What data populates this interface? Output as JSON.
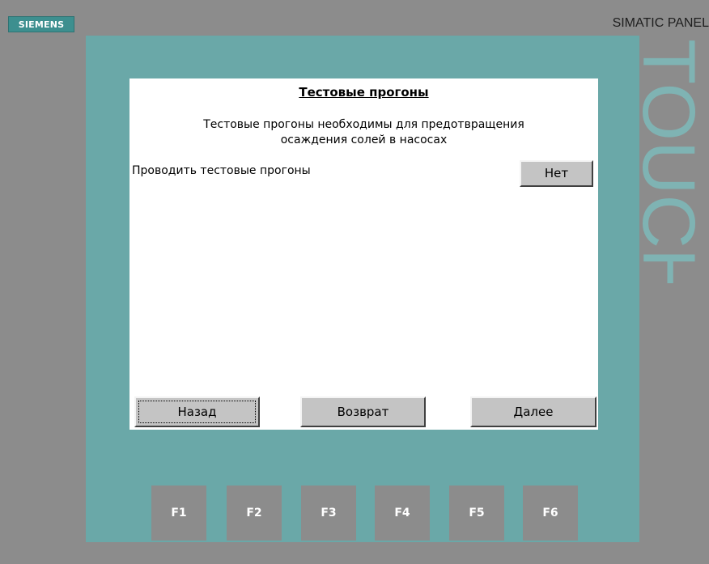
{
  "device": {
    "brand_logo": "SIEMENS",
    "model_label": "SIMATIC PANEL",
    "side_word": "TOUCH",
    "colors": {
      "housing": "#8c8c8c",
      "bezel": "#6aa8a8",
      "logo_bg": "#3d8f8f"
    }
  },
  "screen": {
    "title": "Тестовые прогоны",
    "description_line1": "Тестовые прогоны необходимы для предотвращения",
    "description_line2": "осаждения солей в  насосах",
    "option_label": "Проводить тестовые прогоны",
    "option_value": "Нет",
    "buttons": {
      "back": "Назад",
      "return": "Возврат",
      "next": "Далее"
    }
  },
  "function_keys": [
    "F1",
    "F2",
    "F3",
    "F4",
    "F5",
    "F6"
  ]
}
